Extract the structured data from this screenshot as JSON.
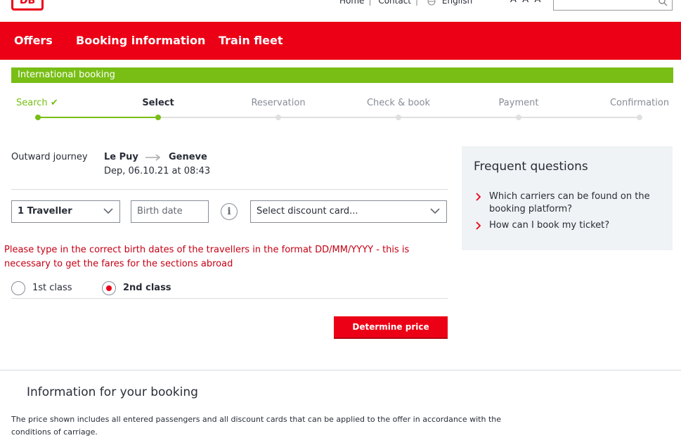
{
  "header": {
    "logo": "DB",
    "links": [
      "Home",
      "Contact"
    ],
    "language": "English",
    "font_size_controls": [
      "A",
      "A",
      "A"
    ],
    "search_placeholder": ""
  },
  "nav": {
    "items": [
      "Offers",
      "Booking information",
      "Train fleet"
    ]
  },
  "banner": {
    "title": "International booking"
  },
  "stepper": {
    "steps": [
      {
        "label": "Search",
        "state": "done"
      },
      {
        "label": "Select",
        "state": "active"
      },
      {
        "label": "Reservation",
        "state": "pending"
      },
      {
        "label": "Check & book",
        "state": "pending"
      },
      {
        "label": "Payment",
        "state": "pending"
      },
      {
        "label": "Confirmation",
        "state": "pending"
      }
    ],
    "check_glyph": "✔"
  },
  "journey": {
    "label": "Outward journey",
    "from": "Le Puy",
    "to": "Geneve",
    "departure": "Dep, 06.10.21 at 08:43"
  },
  "form": {
    "traveller_value": "1 Traveller",
    "birth_placeholder": "Birth date",
    "info_glyph": "i",
    "discount_placeholder": "Select discount card...",
    "error_message": "Please type in the correct birth dates of the travellers in the format DD/MM/YYYY - this is necessary to get the fares for the sections abroad",
    "classes": [
      {
        "label": "1st class",
        "checked": false
      },
      {
        "label": "2nd class",
        "checked": true
      }
    ],
    "submit_label": "Determine price"
  },
  "faq": {
    "title": "Frequent questions",
    "items": [
      "Which carriers can be found on the booking platform?",
      "How can I book my ticket?"
    ]
  },
  "info": {
    "title": "Information for your booking",
    "text": "The price shown includes all entered passengers and all discount cards that can be applied to the offer in accordance with the conditions of carriage."
  },
  "colors": {
    "brand_red": "#ec0016",
    "success_green": "#78be14",
    "error_red": "#c50014",
    "panel_gray": "#f0f3f5"
  }
}
